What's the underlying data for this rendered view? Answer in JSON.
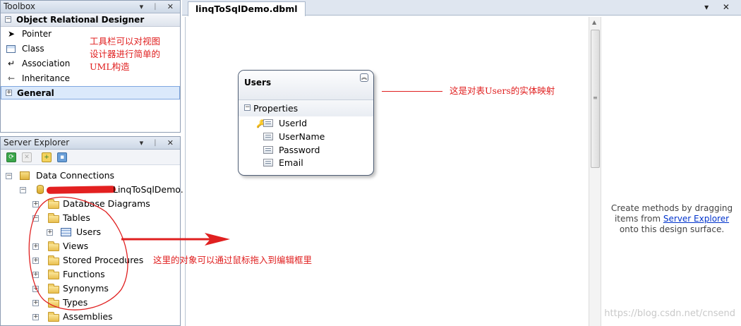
{
  "toolbox": {
    "title": "Toolbox",
    "window_controls": "▾ ᛁ ✕",
    "group_ord": "Object Relational Designer",
    "items": [
      {
        "label": "Pointer",
        "icon": "pointer-icon"
      },
      {
        "label": "Class",
        "icon": "class-icon"
      },
      {
        "label": "Association",
        "icon": "association-icon"
      },
      {
        "label": "Inheritance",
        "icon": "inheritance-icon"
      }
    ],
    "group_general": "General"
  },
  "server_explorer": {
    "title": "Server Explorer",
    "window_controls": "▾ ᛁ ✕",
    "root": "Data Connections",
    "connection": "LinqToSqlDemo.",
    "nodes": {
      "db_diagrams": "Database Diagrams",
      "tables": "Tables",
      "users": "Users",
      "views": "Views",
      "stored_procedures": "Stored Procedures",
      "functions": "Functions",
      "synonyms": "Synonyms",
      "types": "Types",
      "assemblies": "Assemblies"
    }
  },
  "document": {
    "tab_label": "linqToSqlDemo.dbml",
    "tab_controls": "▾ ✕"
  },
  "entity": {
    "name": "Users",
    "section": "Properties",
    "properties": [
      "UserId",
      "UserName",
      "Password",
      "Email"
    ]
  },
  "methods_pane": {
    "line1": "Create methods by dragging",
    "line2_prefix": "items from ",
    "line2_link": "Server Explorer",
    "line3": "onto this design surface."
  },
  "annotations": {
    "toolbox_note": [
      "工具栏可以对视图",
      "设计器进行简单的",
      "UML构造"
    ],
    "entity_note": "这是对表Users的实体映射",
    "drag_note": "这里的对象可以通过鼠标拖入到编辑框里"
  },
  "watermark": "https://blog.csdn.net/cnsend",
  "colors": {
    "annotation_red": "#e02020",
    "link_blue": "#0033cc",
    "selection": "#dbe9fb"
  }
}
